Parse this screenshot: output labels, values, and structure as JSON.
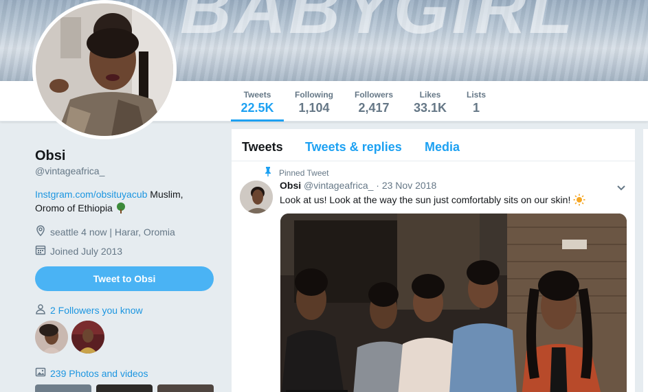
{
  "banner": {
    "text": "BABYGIRL"
  },
  "profile": {
    "name": "Obsi",
    "handle": "@vintageafrica_",
    "bio_link": "Instgram.com/obsituyacub",
    "bio_text": " Muslim, Oromo of Ethiopia ",
    "location": "seattle 4 now | Harar, Oromia",
    "joined": "Joined July 2013",
    "tweet_to_label": "Tweet to Obsi",
    "followers_you_know": "2 Followers you know",
    "photos_videos": "239 Photos and videos"
  },
  "stats": [
    {
      "label": "Tweets",
      "value": "22.5K"
    },
    {
      "label": "Following",
      "value": "1,104"
    },
    {
      "label": "Followers",
      "value": "2,417"
    },
    {
      "label": "Likes",
      "value": "33.1K"
    },
    {
      "label": "Lists",
      "value": "1"
    }
  ],
  "timeline": {
    "tabs": [
      "Tweets",
      "Tweets & replies",
      "Media"
    ],
    "pinned_label": "Pinned Tweet",
    "tweet": {
      "name": "Obsi",
      "handle": "@vintageafrica_",
      "date": "· 23 Nov 2018",
      "text": "Look at us! Look at the way the sun just comfortably sits on our skin! "
    }
  },
  "colors": {
    "accent": "#1da1f2",
    "button": "#4ab3f4",
    "background": "#e6ecf0"
  }
}
